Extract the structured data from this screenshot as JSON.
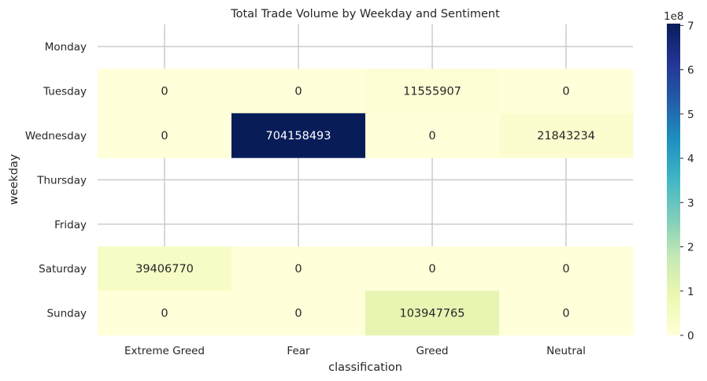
{
  "chart_data": {
    "type": "heatmap",
    "title": "Total Trade Volume by Weekday and Sentiment",
    "xlabel": "classification",
    "ylabel": "weekday",
    "x_categories": [
      "Extreme Greed",
      "Fear",
      "Greed",
      "Neutral"
    ],
    "y_categories": [
      "Monday",
      "Tuesday",
      "Wednesday",
      "Thursday",
      "Friday",
      "Saturday",
      "Sunday"
    ],
    "values": [
      [
        null,
        null,
        null,
        null
      ],
      [
        0,
        0,
        11555907,
        0
      ],
      [
        0,
        704158493,
        0,
        21843234
      ],
      [
        null,
        null,
        null,
        null
      ],
      [
        null,
        null,
        null,
        null
      ],
      [
        39406770,
        0,
        0,
        0
      ],
      [
        0,
        0,
        103947765,
        0
      ]
    ],
    "cell_labels": [
      [
        "",
        "",
        "",
        ""
      ],
      [
        "0",
        "0",
        "11555907",
        "0"
      ],
      [
        "0",
        "704158493",
        "0",
        "21843234"
      ],
      [
        "",
        "",
        "",
        ""
      ],
      [
        "",
        "",
        "",
        ""
      ],
      [
        "39406770",
        "0",
        "0",
        "0"
      ],
      [
        "0",
        "0",
        "103947765",
        "0"
      ]
    ],
    "colorbar": {
      "colormap": "YlGnBu",
      "range": [
        0,
        704158493
      ],
      "ticks": [
        0,
        1,
        2,
        3,
        4,
        5,
        6,
        7
      ],
      "tick_labels": [
        "0",
        "1",
        "2",
        "3",
        "4",
        "5",
        "6",
        "7"
      ],
      "scale_label": "1e8",
      "tick_scale": 100000000
    },
    "grid": true
  }
}
